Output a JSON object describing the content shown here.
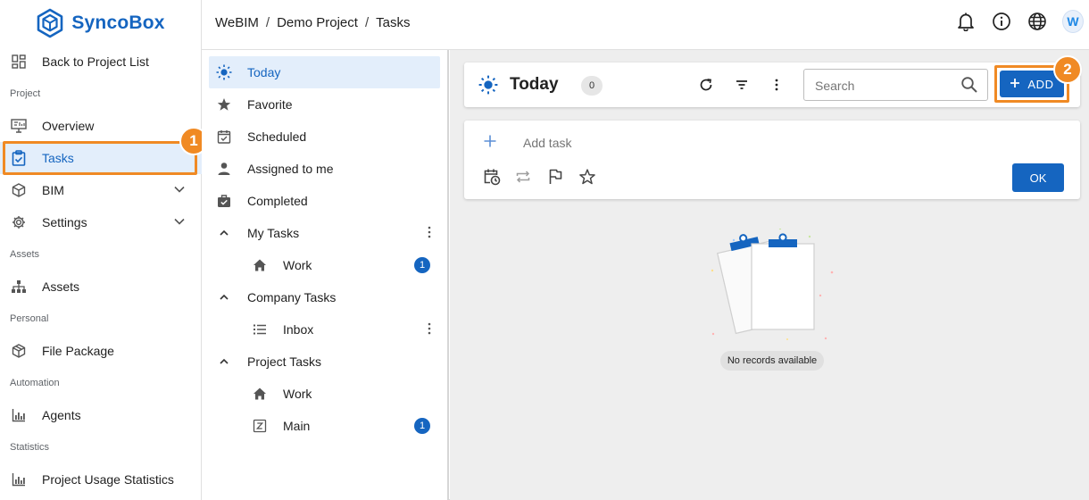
{
  "app": {
    "name": "SyncoBox",
    "brand_color": "#1565c0",
    "accent_color": "#f08a24"
  },
  "breadcrumb": [
    "WeBIM",
    "Demo Project",
    "Tasks"
  ],
  "breadcrumb_sep": "/",
  "topbar_icons": [
    "bell-icon",
    "info-icon",
    "globe-icon",
    "user-avatar"
  ],
  "avatar_letter": "W",
  "sidebar": {
    "back": "Back to Project List",
    "sections": {
      "project": "Project",
      "assets": "Assets",
      "personal": "Personal",
      "automation": "Automation",
      "statistics": "Statistics"
    },
    "items": {
      "overview": "Overview",
      "tasks": "Tasks",
      "bim": "BIM",
      "settings": "Settings",
      "assets": "Assets",
      "file_package": "File Package",
      "agents": "Agents",
      "usage": "Project Usage Statistics"
    },
    "active": "tasks"
  },
  "task_nav": {
    "today": "Today",
    "favorite": "Favorite",
    "scheduled": "Scheduled",
    "assigned": "Assigned to me",
    "completed": "Completed",
    "my_tasks": {
      "label": "My Tasks",
      "children": [
        {
          "label": "Work",
          "count": "1"
        }
      ]
    },
    "company_tasks": {
      "label": "Company Tasks",
      "children": [
        {
          "label": "Inbox"
        }
      ]
    },
    "project_tasks": {
      "label": "Project Tasks",
      "children": [
        {
          "label": "Work"
        },
        {
          "label": "Main",
          "count": "1"
        }
      ]
    }
  },
  "main": {
    "title": "Today",
    "count": "0",
    "search_placeholder": "Search",
    "add_label": "ADD",
    "add_task_placeholder": "Add task",
    "ok_label": "OK",
    "empty_text": "No records available"
  },
  "callouts": [
    "1",
    "2"
  ]
}
